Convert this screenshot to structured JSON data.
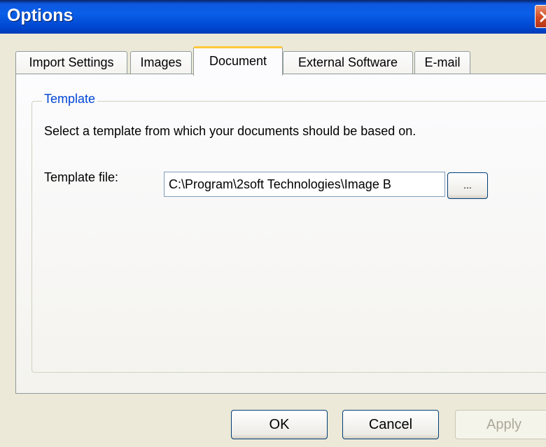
{
  "window": {
    "title": "Options"
  },
  "tabs": [
    {
      "label": "Import Settings"
    },
    {
      "label": "Images"
    },
    {
      "label": "Document",
      "active": true
    },
    {
      "label": "External Software"
    },
    {
      "label": "E-mail"
    }
  ],
  "template_group": {
    "label": "Template",
    "description": "Select a template from which your documents should be based on.",
    "field_label": "Template file:",
    "field_value": "C:\\Program\\2soft Technologies\\Image B",
    "browse_label": "..."
  },
  "buttons": {
    "ok": "OK",
    "cancel": "Cancel",
    "apply": "Apply"
  },
  "colors": {
    "titlebar": "#0a5fe8",
    "close_button": "#d24a22",
    "active_tab_highlight": "#ffc83c",
    "group_label": "#0046d5",
    "dialog_background": "#ece9d8"
  },
  "icons": {
    "close": "close-icon"
  }
}
